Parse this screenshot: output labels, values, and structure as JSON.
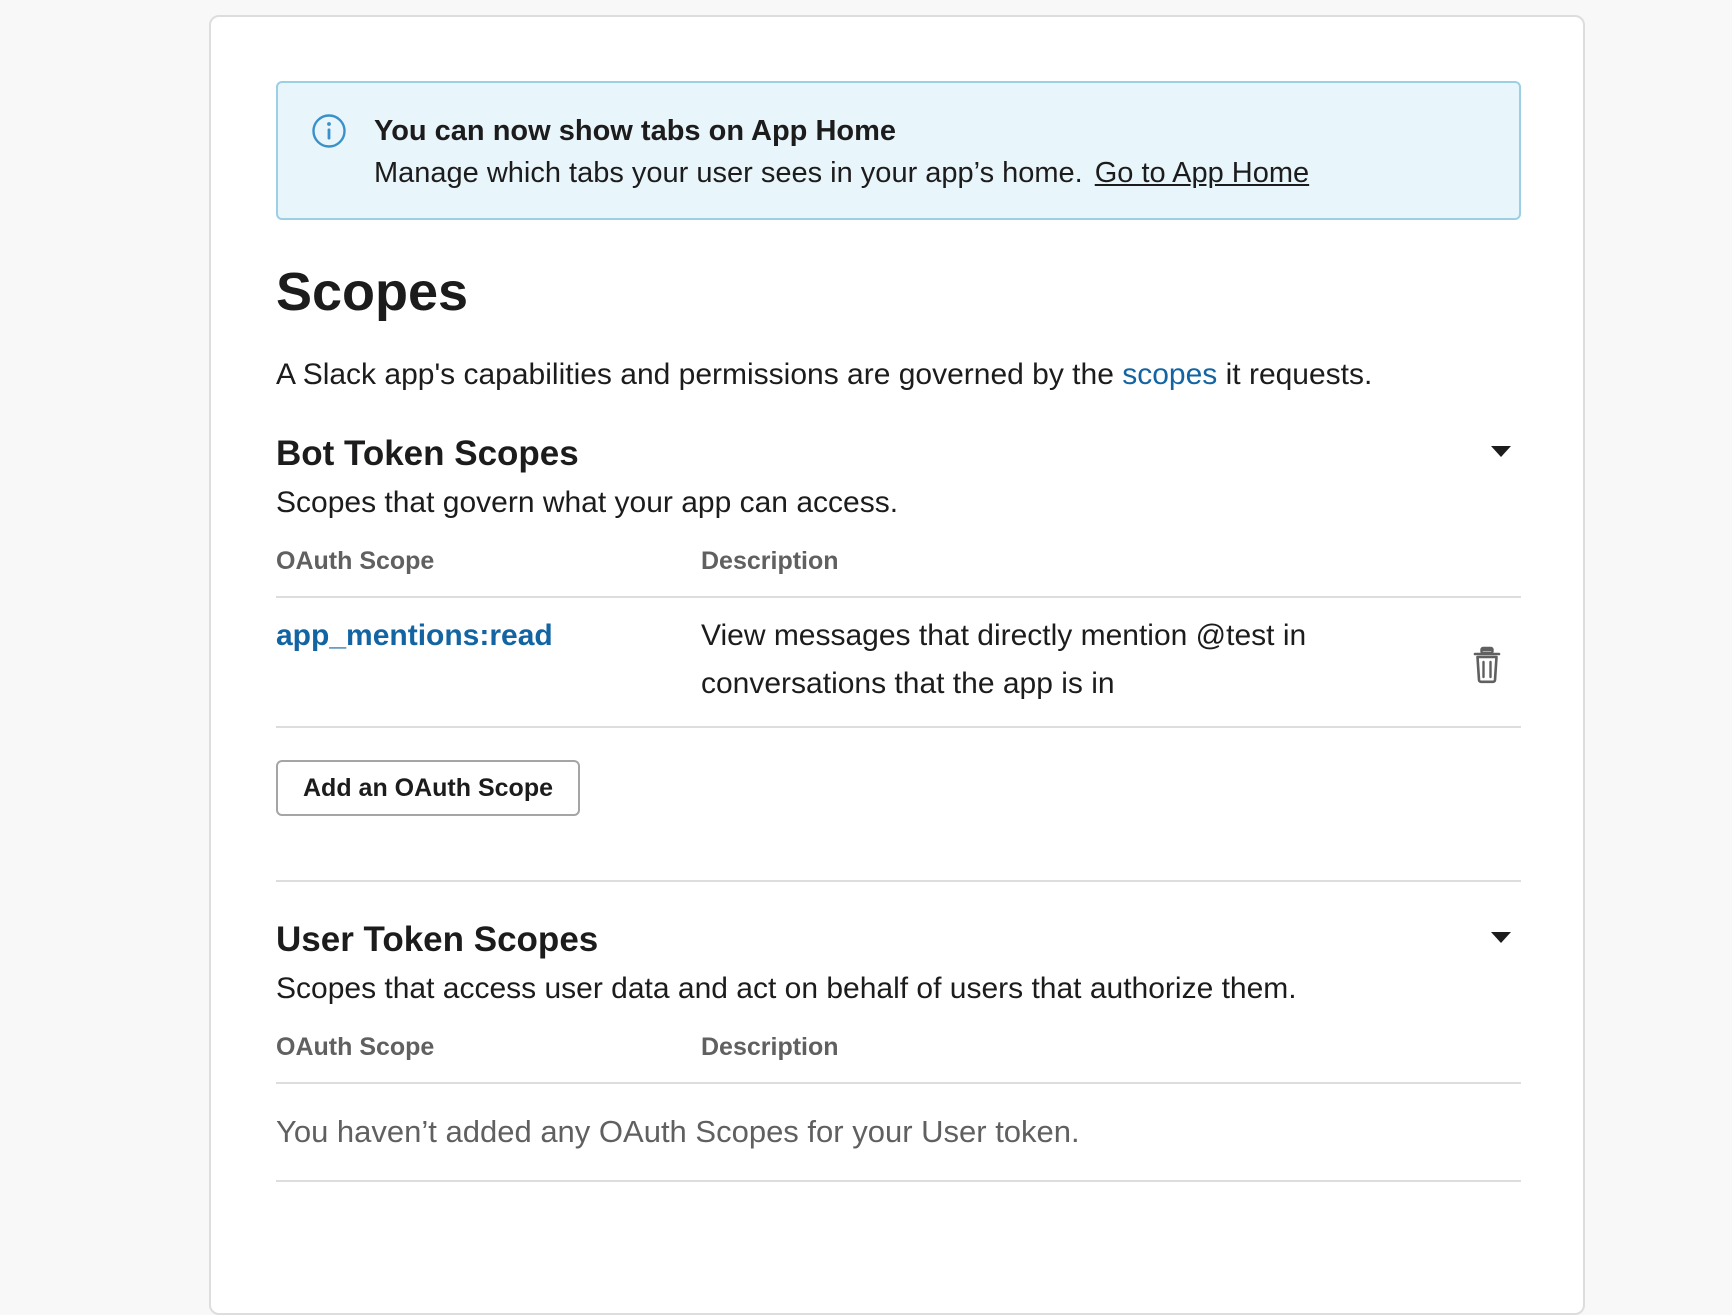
{
  "banner": {
    "icon": "info-icon",
    "title": "You can now show tabs on App Home",
    "body": "Manage which tabs your user sees in your app’s home.",
    "link": "Go to App Home"
  },
  "page": {
    "title": "Scopes",
    "intro_before": "A Slack app's capabilities and permissions are governed by the ",
    "intro_link": "scopes",
    "intro_after": " it requests."
  },
  "bot_section": {
    "title": "Bot Token Scopes",
    "subtitle": "Scopes that govern what your app can access.",
    "columns": [
      "OAuth Scope",
      "Description"
    ],
    "rows": [
      {
        "scope": "app_mentions:read",
        "description": "View messages that directly mention @test in conversations that the app is in"
      }
    ],
    "add_button": "Add an OAuth Scope"
  },
  "user_section": {
    "title": "User Token Scopes",
    "subtitle": "Scopes that access user data and act on behalf of users that authorize them.",
    "columns": [
      "OAuth Scope",
      "Description"
    ],
    "empty_text": "You haven’t added any OAuth Scopes for your User token."
  },
  "colors": {
    "link": "#1264a3",
    "banner_bg": "#e8f5fa",
    "banner_border": "#9ccfe3",
    "text": "#1d1c1d",
    "muted": "#616061"
  }
}
